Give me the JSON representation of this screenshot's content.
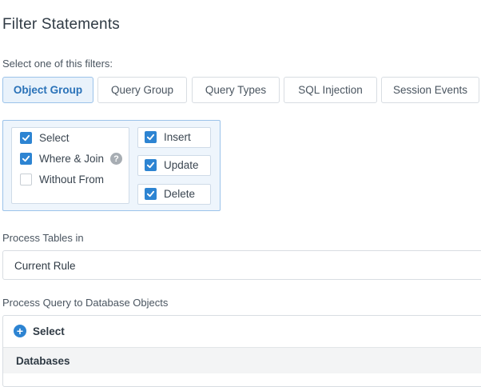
{
  "page": {
    "title": "Filter Statements"
  },
  "filters": {
    "label": "Select one of this filters:",
    "tabs": [
      {
        "label": "Object Group",
        "active": true
      },
      {
        "label": "Query Group",
        "active": false
      },
      {
        "label": "Query Types",
        "active": false
      },
      {
        "label": "SQL Injection",
        "active": false
      },
      {
        "label": "Session Events",
        "active": false
      }
    ]
  },
  "checkboxes": {
    "left": [
      {
        "label": "Select",
        "checked": true
      },
      {
        "label": "Where & Join",
        "checked": true,
        "help": "?"
      },
      {
        "label": "Without From",
        "checked": false
      }
    ],
    "right": [
      {
        "label": "Insert",
        "checked": true
      },
      {
        "label": "Update",
        "checked": true
      },
      {
        "label": "Delete",
        "checked": true
      }
    ]
  },
  "process_tables": {
    "label": "Process Tables in",
    "value": "Current Rule"
  },
  "process_query": {
    "label": "Process Query to Database Objects",
    "select_label": "Select",
    "column_header": "Databases"
  },
  "colors": {
    "accent": "#2d84d2",
    "active_tab_bg": "#e9f2fb",
    "group_bg": "#eef5fc"
  }
}
